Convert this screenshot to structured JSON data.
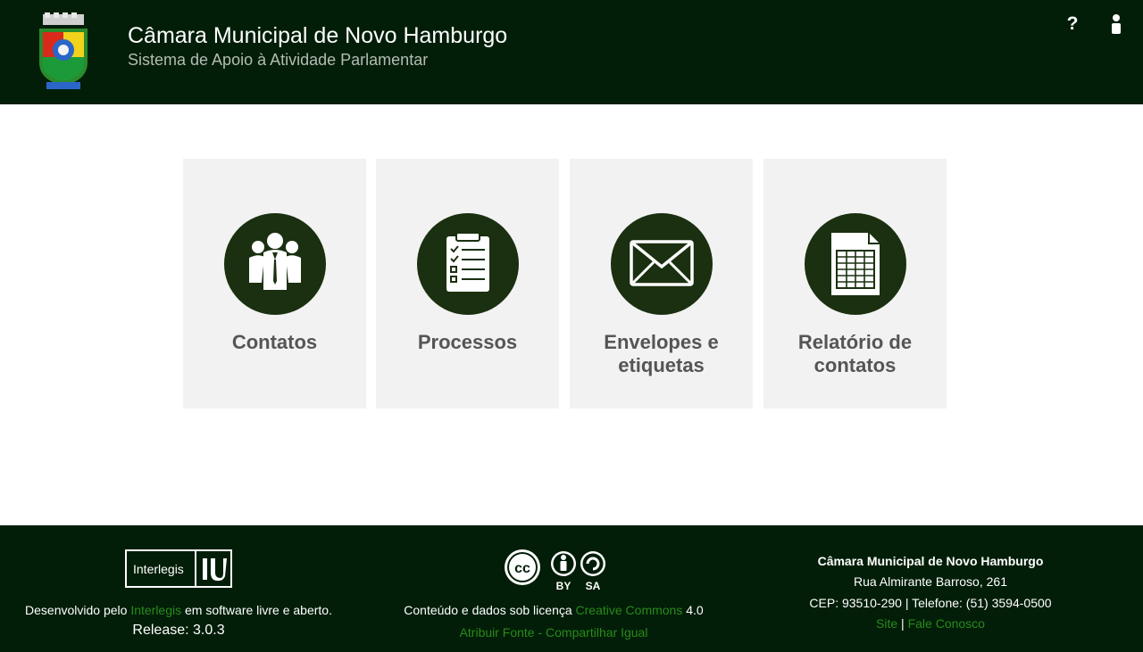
{
  "header": {
    "title": "Câmara Municipal de Novo Hamburgo",
    "subtitle": "Sistema de Apoio à Atividade Parlamentar",
    "help_icon": "?",
    "icons": [
      "crest-logo",
      "help-icon",
      "user-icon"
    ]
  },
  "cards": [
    {
      "label": "Contatos",
      "icon": "people-icon"
    },
    {
      "label": "Processos",
      "icon": "clipboard-icon"
    },
    {
      "label": "Envelopes e etiquetas",
      "icon": "envelope-icon"
    },
    {
      "label": "Relatório de contatos",
      "icon": "spreadsheet-icon"
    }
  ],
  "footer": {
    "interlegis_logo_text": "Interlegis",
    "dev_prefix": "Desenvolvido pelo",
    "dev_link": "Interlegis",
    "dev_suffix": "em software livre e aberto.",
    "release": "Release: 3.0.3",
    "license_prefix": "Conteúdo e dados sob licença",
    "license_link": "Creative Commons",
    "license_version": "4.0",
    "license_sub": "Atribuir Fonte - Compartilhar Igual",
    "cc_badges": [
      "BY",
      "SA"
    ],
    "org_name": "Câmara Municipal de Novo Hamburgo",
    "org_address": "Rua Almirante Barroso, 261",
    "org_contact": "CEP: 93510-290 | Telefone: (51) 3594-0500",
    "link_site": "Site",
    "link_separator": "|",
    "link_contact": "Fale Conosco"
  },
  "colors": {
    "header_bg": "#021e08",
    "card_bg": "#f2f2f2",
    "icon_circle": "#1a3010",
    "link_green": "#2a8a1a",
    "label_gray": "#555555"
  }
}
